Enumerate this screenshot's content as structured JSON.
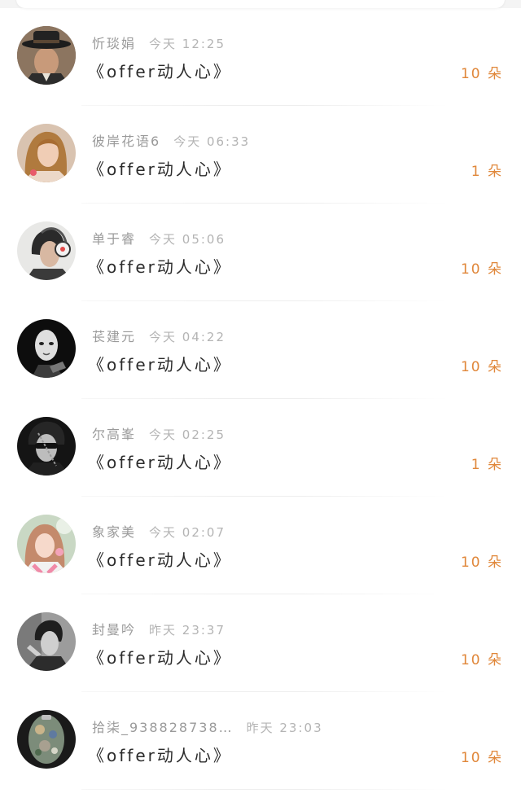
{
  "gifts": [
    {
      "name": "忻琰娟",
      "time": "今天 12:25",
      "title": "《offer动人心》",
      "count": "10 朵",
      "avatar": "avatar-man-hat"
    },
    {
      "name": "彼岸花语6",
      "time": "今天 06:33",
      "title": "《offer动人心》",
      "count": "1 朵",
      "avatar": "avatar-woman-blonde"
    },
    {
      "name": "单于睿",
      "time": "今天 05:06",
      "title": "《offer动人心》",
      "count": "10 朵",
      "avatar": "avatar-man-headphones"
    },
    {
      "name": "苌建元",
      "time": "今天 04:22",
      "title": "《offer动人心》",
      "count": "10 朵",
      "avatar": "avatar-mask"
    },
    {
      "name": "尔高峯",
      "time": "今天 02:25",
      "title": "《offer动人心》",
      "count": "1 朵",
      "avatar": "avatar-man-sunglasses"
    },
    {
      "name": "象家美",
      "time": "今天 02:07",
      "title": "《offer动人心》",
      "count": "10 朵",
      "avatar": "avatar-woman-pink"
    },
    {
      "name": "封曼吟",
      "time": "昨天 23:37",
      "title": "《offer动人心》",
      "count": "10 朵",
      "avatar": "avatar-man-bw"
    },
    {
      "name": "拾柒_938828738…",
      "time": "昨天 23:03",
      "title": "《offer动人心》",
      "count": "10 朵",
      "avatar": "avatar-collage"
    }
  ]
}
